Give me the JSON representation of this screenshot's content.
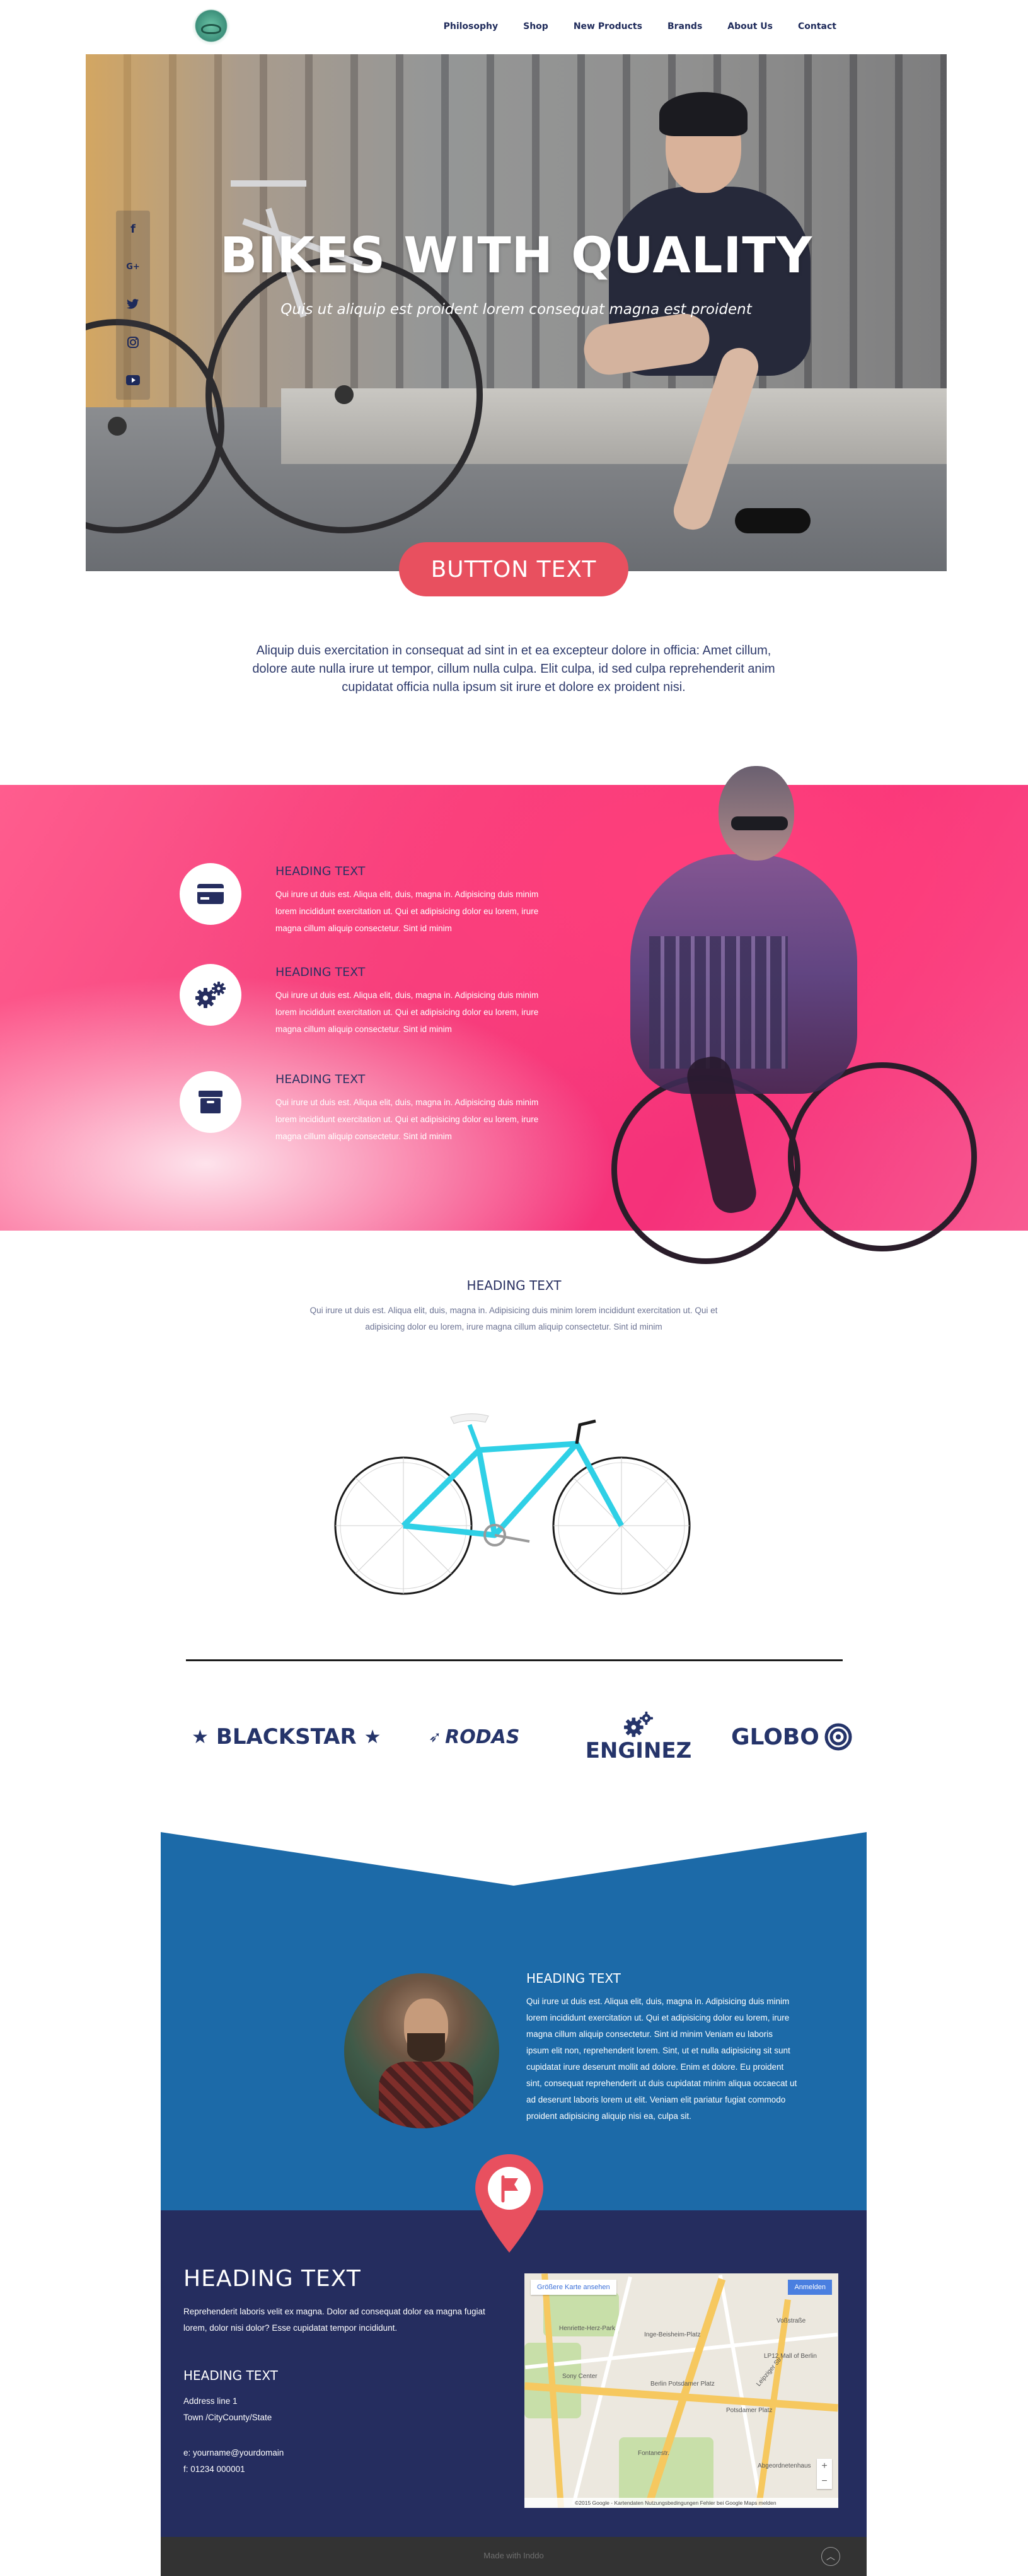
{
  "nav": {
    "links": [
      "Philosophy",
      "Shop",
      "New Products",
      "Brands",
      "About Us",
      "Contact"
    ]
  },
  "hero": {
    "title": "BIKES WITH QUALITY",
    "subtitle": "Quis ut aliquip est proident lorem consequat magna  est proident"
  },
  "social": {
    "icons": [
      "facebook-icon",
      "google-plus-icon",
      "twitter-icon",
      "instagram-icon",
      "youtube-icon"
    ],
    "google_plus_glyph": "G+"
  },
  "cta": {
    "label": "BUTTON TEXT"
  },
  "intro": {
    "text": "Aliquip duis exercitation in consequat ad sint in et ea excepteur dolore in officia: Amet cillum, dolore aute nulla irure ut tempor, cillum nulla culpa. Elit culpa, id sed culpa reprehenderit anim cupidatat officia nulla ipsum sit irure et dolore ex proident nisi."
  },
  "features": [
    {
      "icon": "credit-card-icon",
      "heading": "HEADING TEXT",
      "text": "Qui irure ut duis est. Aliqua elit, duis, magna in. Adipisicing duis minim lorem incididunt exercitation ut. Qui et adipisicing dolor eu lorem, irure magna cillum aliquip consectetur. Sint id minim"
    },
    {
      "icon": "gears-icon",
      "heading": "HEADING TEXT",
      "text": "Qui irure ut duis est. Aliqua elit, duis, magna in. Adipisicing duis minim lorem incididunt exercitation ut. Qui et adipisicing dolor eu lorem, irure magna cillum aliquip consectetur. Sint id minim"
    },
    {
      "icon": "archive-box-icon",
      "heading": "HEADING TEXT",
      "text": "Qui irure ut duis est. Aliqua elit, duis, magna in. Adipisicing duis minim lorem incididunt exercitation ut. Qui et adipisicing dolor eu lorem, irure magna cillum aliquip consectetur. Sint id minim"
    }
  ],
  "middle": {
    "heading": "HEADING TEXT",
    "text": "Qui irure ut duis est. Aliqua elit, duis, magna in. Adipisicing duis minim lorem incididunt exercitation ut. Qui et adipisicing dolor eu lorem, irure magna cillum aliquip consectetur. Sint id minim"
  },
  "brands": [
    "BLACKSTAR",
    "RODAS",
    "ENGINEZ",
    "GLOBO"
  ],
  "about": {
    "heading": "HEADING TEXT",
    "text": "Qui irure ut duis est. Aliqua elit, duis, magna in. Adipisicing duis minim lorem incididunt exercitation ut. Qui et adipisicing dolor eu lorem, irure magna cillum aliquip consectetur. Sint id minim Veniam eu laboris ipsum elit non, reprehenderit lorem. Sint, ut et nulla adipisicing sit sunt cupidatat irure deserunt mollit ad dolore. Enim et dolore. Eu proident sint, consequat reprehenderit ut duis cupidatat minim aliqua occaecat ut ad deserunt laboris lorem ut elit. Veniam elit pariatur fugiat commodo proident adipisicing aliquip nisi ea, culpa sit."
  },
  "contact": {
    "heading": "HEADING TEXT",
    "text": "Reprehenderit laboris velit ex magna. Dolor ad consequat dolor ea magna fugiat lorem, dolor nisi dolor? Esse cupidatat tempor incididunt.",
    "subheading": "HEADING TEXT",
    "address_line": "Address line 1",
    "city_line": "Town /CityCounty/State",
    "email_line": "e: yourname@yourdomain",
    "phone_line": "f: 01234 000001"
  },
  "map": {
    "larger_map": "Größere Karte ansehen",
    "directions": "Anmelden",
    "labels": [
      "Henriette-Herz-Park",
      "Inge-Beisheim-Platz",
      "LP12 Mall of Berlin",
      "Sony Center",
      "Berlin Potsdamer Platz",
      "Potsdamer Platz",
      "Fontanestr.",
      "Abgeordnetenhaus",
      "Leipziger Str.",
      "Voßstraße"
    ],
    "attribution": "©2015 Google - Kartendaten   Nutzungsbedingungen   Fehler bei Google Maps melden"
  },
  "footer": {
    "made_with": "Made with Inddo"
  },
  "colors": {
    "navy": "#252d5f",
    "blue": "#1c6aa8",
    "accent": "#e8505f",
    "pink": "#f43f7c"
  }
}
